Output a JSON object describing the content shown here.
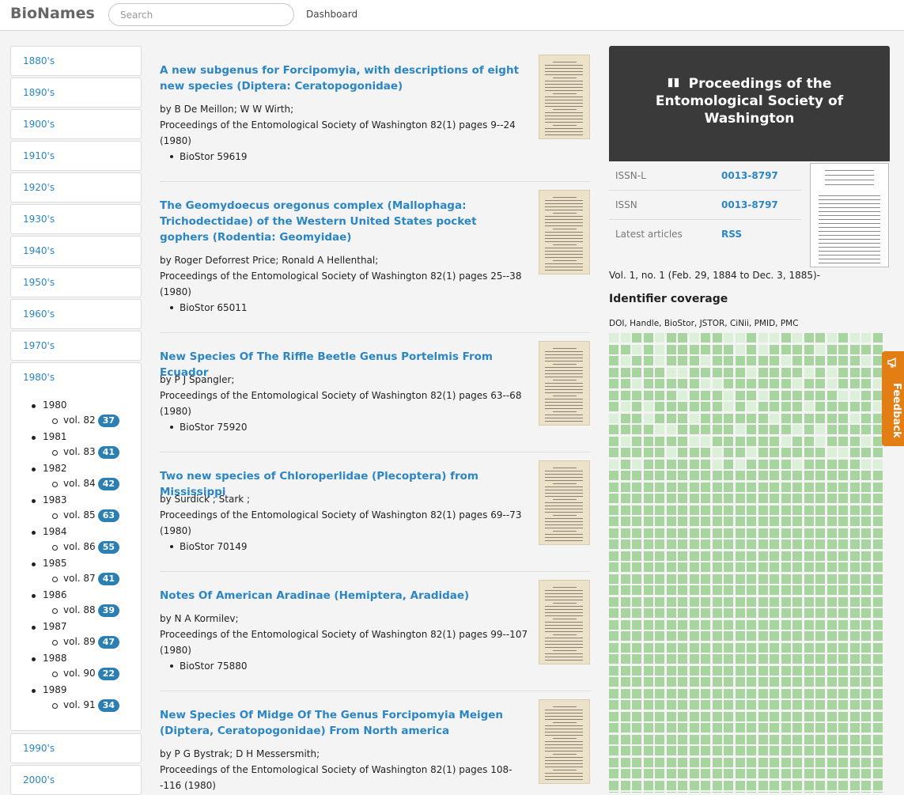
{
  "brand": "BioNames",
  "search": {
    "placeholder": "Search"
  },
  "nav": {
    "dashboard": "Dashboard"
  },
  "decades": [
    "1880's",
    "1890's",
    "1900's",
    "1910's",
    "1920's",
    "1930's",
    "1940's",
    "1950's",
    "1960's",
    "1970's",
    "1980's",
    "1990's",
    "2000's"
  ],
  "open_decade": {
    "label": "1980's",
    "years": [
      {
        "year": "1980",
        "vol": "vol. 82",
        "count": "37"
      },
      {
        "year": "1981",
        "vol": "vol. 83",
        "count": "41"
      },
      {
        "year": "1982",
        "vol": "vol. 84",
        "count": "42"
      },
      {
        "year": "1983",
        "vol": "vol. 85",
        "count": "63"
      },
      {
        "year": "1984",
        "vol": "vol. 86",
        "count": "55"
      },
      {
        "year": "1985",
        "vol": "vol. 87",
        "count": "41"
      },
      {
        "year": "1986",
        "vol": "vol. 88",
        "count": "39"
      },
      {
        "year": "1987",
        "vol": "vol. 89",
        "count": "47"
      },
      {
        "year": "1988",
        "vol": "vol. 90",
        "count": "22"
      },
      {
        "year": "1989",
        "vol": "vol. 91",
        "count": "34"
      }
    ]
  },
  "articles": [
    {
      "title": "A new subgenus for Forcipomyia, with descriptions of eight new species (Diptera: Ceratopogonidae)",
      "authors": "by B De Meillon; W W Wirth;",
      "citation": "Proceedings of the Entomological Society of Washington 82(1) pages 9--24",
      "year": "(1980)",
      "biostor": "BioStor 59619"
    },
    {
      "title": "The Geomydoecus oregonus complex (Mallophaga: Trichodectidae) of the Western United States pocket gophers (Rodentia: Geomyidae)",
      "authors": "by Roger Deforrest Price; Ronald A Hellenthal;",
      "citation": "Proceedings of the Entomological Society of Washington 82(1) pages 25--38",
      "year": "(1980)",
      "biostor": "BioStor 65011"
    },
    {
      "title": "New Species Of The Riffle Beetle Genus Portelmis From Ecuador",
      "authors": "by P J Spangler;",
      "citation": "Proceedings of the Entomological Society of Washington 82(1) pages 63--68",
      "year": "(1980)",
      "biostor": "BioStor 75920"
    },
    {
      "title": "Two new species of Chloroperlidae (Plecoptera) from Mississippi",
      "authors": "by Surdick ; Stark ;",
      "citation": "Proceedings of the Entomological Society of Washington 82(1) pages 69--73",
      "year": "(1980)",
      "biostor": "BioStor 70149"
    },
    {
      "title": "Notes Of American Aradinae (Hemiptera, Aradidae)",
      "authors": "by N A Kormilev;",
      "citation": "Proceedings of the Entomological Society of Washington 82(1) pages 99--107",
      "year": "(1980)",
      "biostor": "BioStor 75880"
    },
    {
      "title": "New Species Of Midge Of The Genus Forcipomyia Meigen (Diptera, Ceratopogonidae) From North america",
      "authors": "by P G Bystrak; D H Messersmith;",
      "citation": "Proceedings of the Entomological Society of Washington 82(1) pages 108-",
      "year": "-116 (1980)",
      "biostor": ""
    }
  ],
  "journal": {
    "title": "Proceedings of the Entomological Society of Washington",
    "issn_l_label": "ISSN-L",
    "issn_l": "0013-8797",
    "issn_label": "ISSN",
    "issn": "0013-8797",
    "latest_label": "Latest articles",
    "latest": "RSS",
    "volume_range": "Vol. 1, no. 1 (Feb. 29, 1884 to Dec. 3, 1885)-",
    "coverage_heading": "Identifier coverage",
    "coverage_list": "DOI, Handle, BioStor, JSTOR, CiNii, PMID, PMC"
  },
  "feedback": "Feedback",
  "colors": {
    "link": "#2b86c3",
    "badge": "#2b7fb1",
    "coverage_full": "#a8d4a0",
    "coverage_empty": "#dcefd8",
    "feedback": "#e27e14",
    "journal_header": "#3a3a3a"
  }
}
